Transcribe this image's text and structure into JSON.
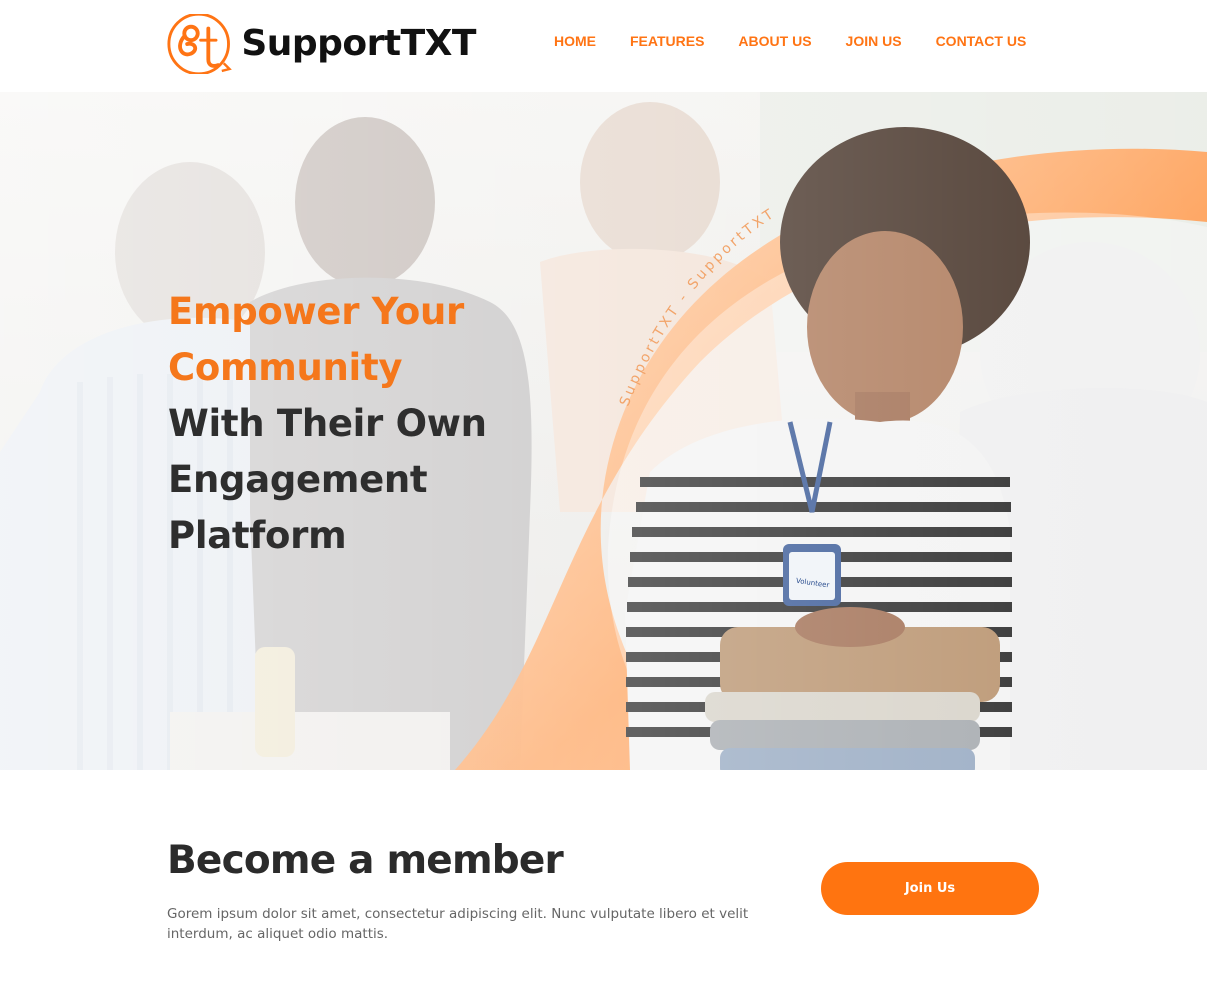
{
  "header": {
    "brand": "SupportTXT",
    "logo_icon": "st-monogram-logo-icon",
    "nav": [
      {
        "label": "HOME"
      },
      {
        "label": "FEATURES"
      },
      {
        "label": "ABOUT US"
      },
      {
        "label": "JOIN US"
      },
      {
        "label": "CONTACT US"
      }
    ]
  },
  "hero": {
    "headline_accent": [
      "Empower Your",
      "Community"
    ],
    "headline_dark": [
      "With Their Own",
      "Engagement",
      "Platform"
    ],
    "arc_text": "SupportTXT - SupportTXT",
    "badge_text": "Volunteer"
  },
  "member": {
    "title": "Become a member",
    "description": "Gorem ipsum dolor sit amet, consectetur adipiscing elit. Nunc vulputate libero et velit interdum, ac aliquet odio mattis.",
    "button_label": "Join Us"
  },
  "colors": {
    "accent": "#ff7414",
    "heading_dark": "#2e2e2e",
    "body_text": "#666666"
  }
}
